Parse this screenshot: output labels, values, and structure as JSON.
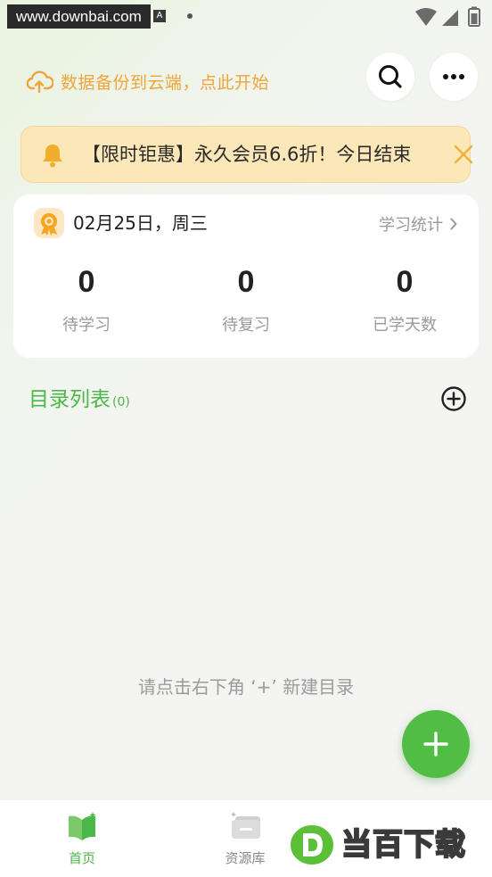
{
  "status_bar": {
    "watermark_url": "www.downbai.com",
    "notif_letter": "A"
  },
  "header": {
    "backup_text": "数据备份到云端，点此开始"
  },
  "promo": {
    "text": "【限时钜惠】永久会员6.6折！今日结束"
  },
  "stats_card": {
    "date": "02月25日，周三",
    "link_label": "学习统计",
    "items": [
      {
        "value": "0",
        "label": "待学习"
      },
      {
        "value": "0",
        "label": "待复习"
      },
      {
        "value": "0",
        "label": "已学天数"
      }
    ]
  },
  "directory": {
    "title": "目录列表",
    "count": "(0)",
    "empty_hint": "请点击右下角 ‘+’ 新建目录"
  },
  "bottom_nav": {
    "items": [
      {
        "label": "首页",
        "icon": "book-icon",
        "active": true
      },
      {
        "label": "资源库",
        "icon": "library-icon",
        "active": false
      }
    ]
  },
  "watermark": {
    "logo_text": "当百下载"
  },
  "colors": {
    "accent_green": "#4cb84a",
    "backup_orange": "#f0a43a",
    "promo_bg": "#fbe7b7",
    "close_orange": "#f0b23c"
  }
}
